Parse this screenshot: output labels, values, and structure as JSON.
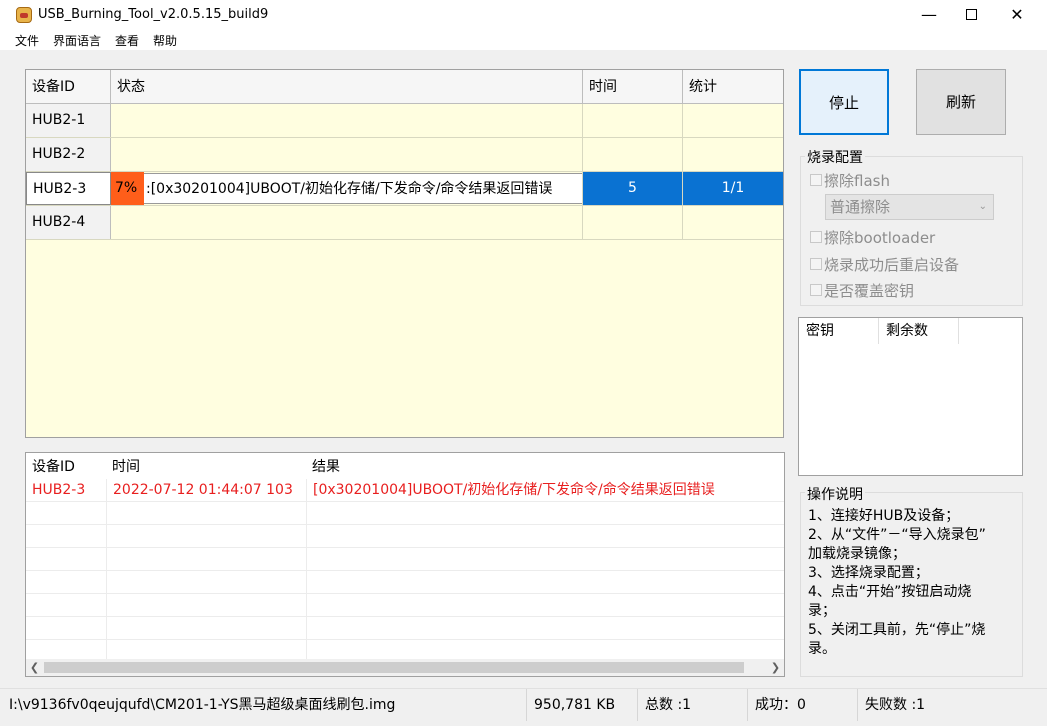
{
  "window": {
    "title": "USB_Burning_Tool_v2.0.5.15_build9",
    "min": "—",
    "close": "✕"
  },
  "menu": [
    "文件",
    "界面语言",
    "查看",
    "帮助"
  ],
  "grid": {
    "headers": {
      "id": "设备ID",
      "status": "状态",
      "time": "时间",
      "stat": "统计"
    },
    "rows": [
      {
        "id": "HUB2-1",
        "progress": "",
        "status": "",
        "time": "",
        "stat": ""
      },
      {
        "id": "HUB2-2",
        "progress": "",
        "status": "",
        "time": "",
        "stat": ""
      },
      {
        "id": "HUB2-3",
        "progress": "7%",
        "status": ":[0x30201004]UBOOT/初始化存储/下发命令/命令结果返回错误",
        "time": "5",
        "stat": "1/1"
      },
      {
        "id": "HUB2-4",
        "progress": "",
        "status": "",
        "time": "",
        "stat": ""
      }
    ]
  },
  "log": {
    "headers": {
      "id": "设备ID",
      "time": "时间",
      "result": "结果"
    },
    "rows": [
      {
        "id": "HUB2-3",
        "time": "2022-07-12 01:44:07 103",
        "result": "[0x30201004]UBOOT/初始化存储/下发命令/命令结果返回错误"
      }
    ]
  },
  "buttons": {
    "stop": "停止",
    "refresh": "刷新"
  },
  "config": {
    "title": "烧录配置",
    "erase_flash": "擦除flash",
    "erase_mode": "普通擦除",
    "erase_bootloader": "擦除bootloader",
    "reboot_after": "烧录成功后重启设备",
    "overwrite_key": "是否覆盖密钥"
  },
  "keys": {
    "col1": "密钥",
    "col2": "剩余数"
  },
  "instructions": {
    "title": "操作说明",
    "l1": "1、连接好HUB及设备；",
    "l2a": "2、从“文件”－“导入烧录包”",
    "l2b": "加载烧录镜像；",
    "l3": "3、选择烧录配置；",
    "l4a": "4、点击“开始”按钮启动烧",
    "l4b": "录；",
    "l5a": "5、关闭工具前，先“停止”烧",
    "l5b": "录。"
  },
  "statusbar": {
    "path": "I:\\v9136fv0qeujqufd\\CM201-1-YS黑马超级桌面线刷包.img",
    "size": "950,781 KB",
    "total": "总数 :1",
    "success": "成功：0",
    "fail": "失败数 :1"
  },
  "colors": {
    "progress": "#ff5e1a",
    "selected": "#0a72d2",
    "error": "#e81f1f",
    "grid_bg": "#fffee0"
  }
}
